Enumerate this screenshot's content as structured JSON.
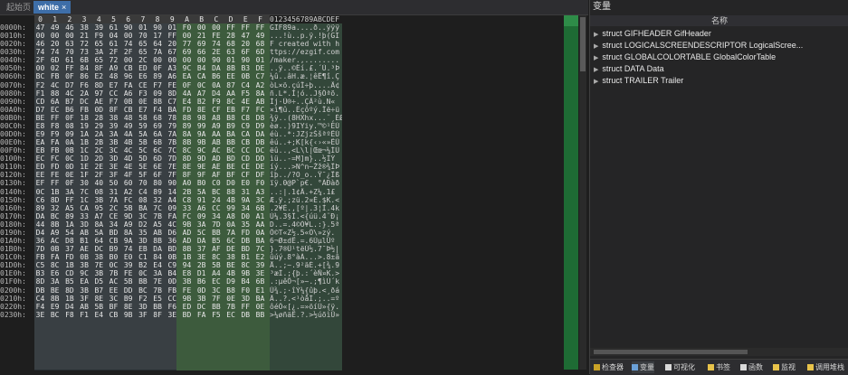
{
  "tabs": {
    "home": "起始页",
    "active": "white",
    "close": "×"
  },
  "header": {
    "cols": [
      "0",
      "1",
      "2",
      "3",
      "4",
      "5",
      "6",
      "7",
      "8",
      "9",
      "A",
      "B",
      "C",
      "D",
      "E",
      "F"
    ],
    "ascii": "0123456789ABCDEF"
  },
  "rows": [
    {
      "off": "0000h:",
      "hex": [
        "47",
        "49",
        "46",
        "38",
        "39",
        "61",
        "90",
        "01",
        "90",
        "01",
        "F0",
        "00",
        "00",
        "FF",
        "FF",
        "FF"
      ],
      "asc": "GIF89a....ð..ÿÿÿ"
    },
    {
      "off": "0010h:",
      "hex": [
        "00",
        "00",
        "00",
        "21",
        "F9",
        "04",
        "00",
        "70",
        "17",
        "FF",
        "00",
        "21",
        "FE",
        "28",
        "47",
        "49"
      ],
      "asc": "...!ù..p.ÿ.!þ(GI"
    },
    {
      "off": "0020h:",
      "hex": [
        "46",
        "20",
        "63",
        "72",
        "65",
        "61",
        "74",
        "65",
        "64",
        "20",
        "77",
        "69",
        "74",
        "68",
        "20",
        "68"
      ],
      "asc": "F created with h"
    },
    {
      "off": "0030h:",
      "hex": [
        "74",
        "74",
        "70",
        "73",
        "3A",
        "2F",
        "2F",
        "65",
        "7A",
        "67",
        "69",
        "66",
        "2E",
        "63",
        "6F",
        "6D"
      ],
      "asc": "ttps://ezgif.com"
    },
    {
      "off": "0040h:",
      "hex": [
        "2F",
        "6D",
        "61",
        "6B",
        "65",
        "72",
        "00",
        "2C",
        "00",
        "00",
        "00",
        "00",
        "90",
        "01",
        "90",
        "01"
      ],
      "asc": "/maker.,........"
    },
    {
      "off": "0050h:",
      "hex": [
        "00",
        "02",
        "FF",
        "84",
        "8F",
        "A9",
        "CB",
        "ED",
        "0F",
        "A3",
        "9C",
        "B4",
        "DA",
        "8B",
        "B3",
        "DE"
      ],
      "asc": "..ÿ..©Ëí.£.´Ú.³Þ"
    },
    {
      "off": "0060h:",
      "hex": [
        "BC",
        "FB",
        "0F",
        "86",
        "E2",
        "48",
        "96",
        "E6",
        "89",
        "A6",
        "EA",
        "CA",
        "B6",
        "EE",
        "0B",
        "C7"
      ],
      "asc": "¼û..âH.æ.¦êÊ¶î.Ç"
    },
    {
      "off": "0070h:",
      "hex": [
        "F2",
        "4C",
        "D7",
        "F6",
        "8D",
        "E7",
        "FA",
        "CE",
        "F7",
        "FE",
        "0F",
        "0C",
        "0A",
        "87",
        "C4",
        "A2"
      ],
      "asc": "òL×ö.çúÎ÷þ....Ä¢"
    },
    {
      "off": "0080h:",
      "hex": [
        "F1",
        "88",
        "4C",
        "2A",
        "97",
        "CC",
        "A6",
        "F3",
        "09",
        "8D",
        "4A",
        "A7",
        "D4",
        "AA",
        "F5",
        "8A"
      ],
      "asc": "ñ.L*.Ì¦ó..J§Ôªõ."
    },
    {
      "off": "0090h:",
      "hex": [
        "CD",
        "6A",
        "B7",
        "DC",
        "AE",
        "F7",
        "0B",
        "0E",
        "8B",
        "C7",
        "E4",
        "B2",
        "F9",
        "8C",
        "4E",
        "AB"
      ],
      "asc": "Íj·Ü®÷..ÇÄ²ù.N«"
    },
    {
      "off": "00A0h:",
      "hex": [
        "D7",
        "EC",
        "B6",
        "FB",
        "0D",
        "8F",
        "CB",
        "E7",
        "F4",
        "BA",
        "FD",
        "8E",
        "CF",
        "EB",
        "F7",
        "FC"
      ],
      "asc": "×ì¶û..Ëçôºý.Ïë÷ü"
    },
    {
      "off": "00B0h:",
      "hex": [
        "BE",
        "FF",
        "0F",
        "18",
        "28",
        "38",
        "48",
        "58",
        "68",
        "78",
        "88",
        "98",
        "A8",
        "B8",
        "C8",
        "D8"
      ],
      "asc": "¾ÿ..(8HXhx...¨¸ÈØ"
    },
    {
      "off": "00C0h:",
      "hex": [
        "E8",
        "F8",
        "08",
        "19",
        "29",
        "39",
        "49",
        "59",
        "69",
        "79",
        "89",
        "99",
        "A9",
        "B9",
        "C9",
        "D9"
      ],
      "asc": "èø..)9IYiy.™©¹ÉÙ"
    },
    {
      "off": "00D0h:",
      "hex": [
        "E9",
        "F9",
        "09",
        "1A",
        "2A",
        "3A",
        "4A",
        "5A",
        "6A",
        "7A",
        "8A",
        "9A",
        "AA",
        "BA",
        "CA",
        "DA"
      ],
      "asc": "éù..*:JZjzŠšªºÊÚ"
    },
    {
      "off": "00E0h:",
      "hex": [
        "EA",
        "FA",
        "0A",
        "1B",
        "2B",
        "3B",
        "4B",
        "5B",
        "6B",
        "7B",
        "8B",
        "9B",
        "AB",
        "BB",
        "CB",
        "DB"
      ],
      "asc": "êú..+;K[k{‹›«»ËÛ"
    },
    {
      "off": "00F0h:",
      "hex": [
        "EB",
        "FB",
        "0B",
        "1C",
        "2C",
        "3C",
        "4C",
        "5C",
        "6C",
        "7C",
        "8C",
        "9C",
        "AC",
        "BC",
        "CC",
        "DC"
      ],
      "asc": "ëû..,<L\\l|Œœ¬¼ÌÜ"
    },
    {
      "off": "0100h:",
      "hex": [
        "EC",
        "FC",
        "0C",
        "1D",
        "2D",
        "3D",
        "4D",
        "5D",
        "6D",
        "7D",
        "8D",
        "9D",
        "AD",
        "BD",
        "CD",
        "DD"
      ],
      "asc": "ìü..-=M]m}..­½ÍÝ"
    },
    {
      "off": "0110h:",
      "hex": [
        "ED",
        "FD",
        "0D",
        "1E",
        "2E",
        "3E",
        "4E",
        "5E",
        "6E",
        "7E",
        "8E",
        "9E",
        "AE",
        "BE",
        "CE",
        "DE"
      ],
      "asc": "íý...>N^n~Žž®¾ÎÞ"
    },
    {
      "off": "0120h:",
      "hex": [
        "EE",
        "FE",
        "0E",
        "1F",
        "2F",
        "3F",
        "4F",
        "5F",
        "6F",
        "7F",
        "8F",
        "9F",
        "AF",
        "BF",
        "CF",
        "DF"
      ],
      "asc": "îþ../?O_o..Ÿ¯¿Ïß"
    },
    {
      "off": "0130h:",
      "hex": [
        "EF",
        "FF",
        "0F",
        "30",
        "40",
        "50",
        "60",
        "70",
        "80",
        "90",
        "A0",
        "B0",
        "C0",
        "D0",
        "E0",
        "F0"
      ],
      "asc": "ïÿ.0@P`p€. °ÀÐàð"
    },
    {
      "off": "0140h:",
      "hex": [
        "0C",
        "1B",
        "3A",
        "7C",
        "08",
        "31",
        "A2",
        "C4",
        "89",
        "14",
        "2B",
        "5A",
        "BC",
        "88",
        "31",
        "A3"
      ],
      "asc": "..:|.1¢Ä.+Z¼.1£"
    },
    {
      "off": "0150h:",
      "hex": [
        "C6",
        "8D",
        "FF",
        "1C",
        "3B",
        "7A",
        "FC",
        "08",
        "32",
        "A4",
        "C8",
        "91",
        "24",
        "4B",
        "9A",
        "3C"
      ],
      "asc": "Æ.ÿ.;zü.2¤È.$K.<"
    },
    {
      "off": "0160h:",
      "hex": [
        "89",
        "32",
        "A5",
        "CA",
        "95",
        "2C",
        "5B",
        "BA",
        "7C",
        "09",
        "33",
        "A6",
        "CC",
        "99",
        "34",
        "6B"
      ],
      "asc": ".2¥Ê.,[º|.3¦Ì.4k"
    },
    {
      "off": "0170h:",
      "hex": [
        "DA",
        "BC",
        "89",
        "33",
        "A7",
        "CE",
        "9D",
        "3C",
        "7B",
        "FA",
        "FC",
        "09",
        "34",
        "A8",
        "D0",
        "A1"
      ],
      "asc": "Ú¼.3§Î.<{úü.4¨Ð¡"
    },
    {
      "off": "0180h:",
      "hex": [
        "44",
        "8B",
        "1A",
        "3D",
        "8A",
        "34",
        "A9",
        "D2",
        "A5",
        "4C",
        "9B",
        "3A",
        "7D",
        "0A",
        "35",
        "AA"
      ],
      "asc": "D..=.4©Ò¥L.:}.5ª"
    },
    {
      "off": "0190h:",
      "hex": [
        "D4",
        "A9",
        "54",
        "AB",
        "5A",
        "BD",
        "8A",
        "35",
        "AB",
        "D6",
        "AD",
        "5C",
        "BB",
        "7A",
        "FD",
        "0A"
      ],
      "asc": "Ô©T«Z½.5«Ö­\\»zý."
    },
    {
      "off": "01A0h:",
      "hex": [
        "36",
        "AC",
        "D8",
        "B1",
        "64",
        "CB",
        "9A",
        "3D",
        "8B",
        "36",
        "AD",
        "DA",
        "B5",
        "6C",
        "DB",
        "BA"
      ],
      "asc": "6¬Ø±dË.=.6­ÚµlÛº"
    },
    {
      "off": "01B0h:",
      "hex": [
        "7D",
        "0B",
        "37",
        "AE",
        "DC",
        "B9",
        "74",
        "EB",
        "DA",
        "BD",
        "8B",
        "37",
        "AF",
        "DE",
        "BD",
        "7C"
      ],
      "asc": "}.7®Ü¹tëÚ½.7¯Þ½|"
    },
    {
      "off": "01C0h:",
      "hex": [
        "FB",
        "FA",
        "FD",
        "0B",
        "38",
        "B0",
        "E0",
        "C1",
        "84",
        "0B",
        "1B",
        "3E",
        "8C",
        "38",
        "B1",
        "E2"
      ],
      "asc": "ûúý.8°àÁ...>.8±â"
    },
    {
      "off": "01D0h:",
      "hex": [
        "C5",
        "8C",
        "1B",
        "3B",
        "7E",
        "0C",
        "39",
        "B2",
        "E4",
        "C9",
        "94",
        "2B",
        "5B",
        "BE",
        "8C",
        "39"
      ],
      "asc": "Å..;~.9²äÉ.+[¾.9"
    },
    {
      "off": "01E0h:",
      "hex": [
        "B3",
        "E6",
        "CD",
        "9C",
        "3B",
        "7B",
        "FE",
        "0C",
        "3A",
        "B4",
        "E8",
        "D1",
        "A4",
        "4B",
        "9B",
        "3E"
      ],
      "asc": "³æÍ.;{þ.:´èÑ¤K.>"
    },
    {
      "off": "01F0h:",
      "hex": [
        "8D",
        "3A",
        "B5",
        "EA",
        "D5",
        "AC",
        "5B",
        "BB",
        "7E",
        "0D",
        "3B",
        "B6",
        "EC",
        "D9",
        "B4",
        "6B"
      ],
      "asc": ".:µêÕ¬[»~.;¶ìÙ´k"
    },
    {
      "off": "0200h:",
      "hex": [
        "DB",
        "BE",
        "8D",
        "3B",
        "B7",
        "EE",
        "DD",
        "BC",
        "7B",
        "FB",
        "FE",
        "0D",
        "3C",
        "B8",
        "F0",
        "E1"
      ],
      "asc": "Û¾.;·îÝ¼{ûþ.<¸ðá"
    },
    {
      "off": "0210h:",
      "hex": [
        "C4",
        "8B",
        "1B",
        "3F",
        "8E",
        "3C",
        "B9",
        "F2",
        "E5",
        "CC",
        "9B",
        "3B",
        "7F",
        "0E",
        "3D",
        "BA"
      ],
      "asc": "Ä..?.<¹òåÌ.;..=º"
    },
    {
      "off": "0220h:",
      "hex": [
        "F4",
        "E9",
        "D4",
        "AB",
        "5B",
        "BF",
        "8E",
        "3D",
        "BB",
        "F6",
        "ED",
        "DC",
        "BB",
        "7B",
        "FF",
        "0E"
      ],
      "asc": "ôéÔ«[¿.=»öíÜ»{ÿ."
    },
    {
      "off": "0230h:",
      "hex": [
        "3E",
        "BC",
        "F8",
        "F1",
        "E4",
        "CB",
        "9B",
        "3F",
        "8F",
        "3E",
        "BD",
        "FA",
        "F5",
        "EC",
        "DB",
        "BB"
      ],
      "asc": ">¼øñäË.?.>½úõìÛ»"
    }
  ],
  "right_panel": {
    "title": "变量",
    "column_name": "名称",
    "items": [
      "struct GIFHEADER GifHeader",
      "struct LOGICALSCREENDESCRIPTOR LogicalScree...",
      "struct GLOBALCOLORTABLE GlobalColorTable",
      "struct DATA Data",
      "struct TRAILER Trailer"
    ]
  },
  "bottom_tabs": [
    "检查器",
    "变量",
    "可视化",
    "书签",
    "函数",
    "监视",
    "调用堆栈"
  ],
  "colors": {
    "accent": "#3e6ea8",
    "selection": "#5f8fae",
    "minimap": "#1e6b34"
  }
}
